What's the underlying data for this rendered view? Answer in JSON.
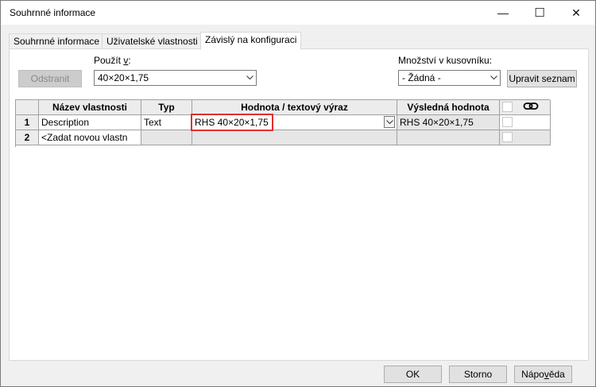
{
  "window": {
    "title": "Souhrnné informace"
  },
  "titlebar_buttons": {
    "minimize": "—",
    "maximize": "☐",
    "close": "✕"
  },
  "tabs": [
    {
      "label": "Souhrnné informace"
    },
    {
      "label": "Uživatelské vlastnosti"
    },
    {
      "label": "Závislý na konfiguraci"
    }
  ],
  "controls": {
    "delete_label": "Odstranit",
    "use_in_label_pre": "Použít ",
    "use_in_label_key": "v",
    "use_in_label_post": ":",
    "use_in_value": "40×20×1,75",
    "bom_qty_label": "Množství v kusovníku:",
    "bom_qty_value": "- Žádná -",
    "edit_list_label": "Upravit seznam"
  },
  "grid": {
    "headers": {
      "name": "Název vlastnosti",
      "type": "Typ",
      "value": "Hodnota / textový výraz",
      "result": "Výsledná hodnota"
    },
    "rows": [
      {
        "num": "1",
        "name": "Description",
        "type": "Text",
        "value": "RHS 40×20×1,75",
        "result": "RHS 40×20×1,75"
      },
      {
        "num": "2",
        "name": "<Zadat novou vlastn",
        "type": "",
        "value": "",
        "result": ""
      }
    ]
  },
  "footer": {
    "ok": "OK",
    "cancel": "Storno",
    "help_pre": "Nápo",
    "help_key": "v",
    "help_post": "ěda"
  },
  "colors": {
    "highlight_box": "#e03030"
  }
}
